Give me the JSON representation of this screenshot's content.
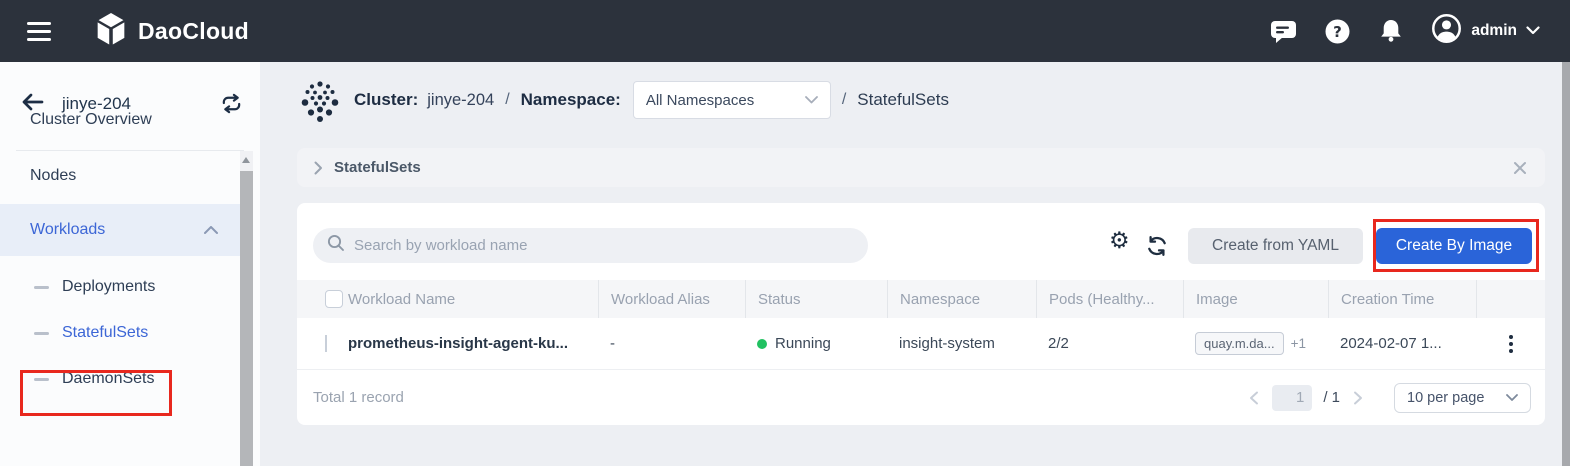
{
  "topbar": {
    "brand": "DaoCloud",
    "user": "admin"
  },
  "icons": {
    "gear": "⚙",
    "help": "?"
  },
  "sidebar": {
    "cluster_name": "jinye-204",
    "items": [
      {
        "label": "Cluster Overview"
      },
      {
        "label": "Nodes"
      },
      {
        "label": "Workloads"
      },
      {
        "label": "Deployments"
      },
      {
        "label": "StatefulSets"
      },
      {
        "label": "DaemonSets"
      }
    ]
  },
  "header": {
    "cluster_label": "Cluster:",
    "cluster_value": "jinye-204",
    "sep1": "/",
    "namespace_label": "Namespace:",
    "namespace_value": "All Namespaces",
    "sep2": "/",
    "page_title": "StatefulSets"
  },
  "breadcrumb": {
    "title": "StatefulSets"
  },
  "toolbar": {
    "search_placeholder": "Search by workload name",
    "create_yaml": "Create from YAML",
    "create_image": "Create By Image"
  },
  "table": {
    "columns": [
      "Workload Name",
      "Workload Alias",
      "Status",
      "Namespace",
      "Pods (Healthy...",
      "Image",
      "Creation Time"
    ],
    "rows": [
      {
        "name": "prometheus-insight-agent-ku...",
        "alias": "-",
        "status": "Running",
        "namespace": "insight-system",
        "pods": "2/2",
        "image": "quay.m.da...",
        "image_extra": "+1",
        "created": "2024-02-07 1..."
      }
    ]
  },
  "pagination": {
    "total": "Total 1 record",
    "current": "1",
    "suffix": "/ 1",
    "per_page": "10 per page"
  },
  "colors": {
    "topbar_bg": "#2c323c",
    "accent_blue": "#2a64d9",
    "running_green": "#21c161",
    "annotation_red": "#e8281e"
  }
}
